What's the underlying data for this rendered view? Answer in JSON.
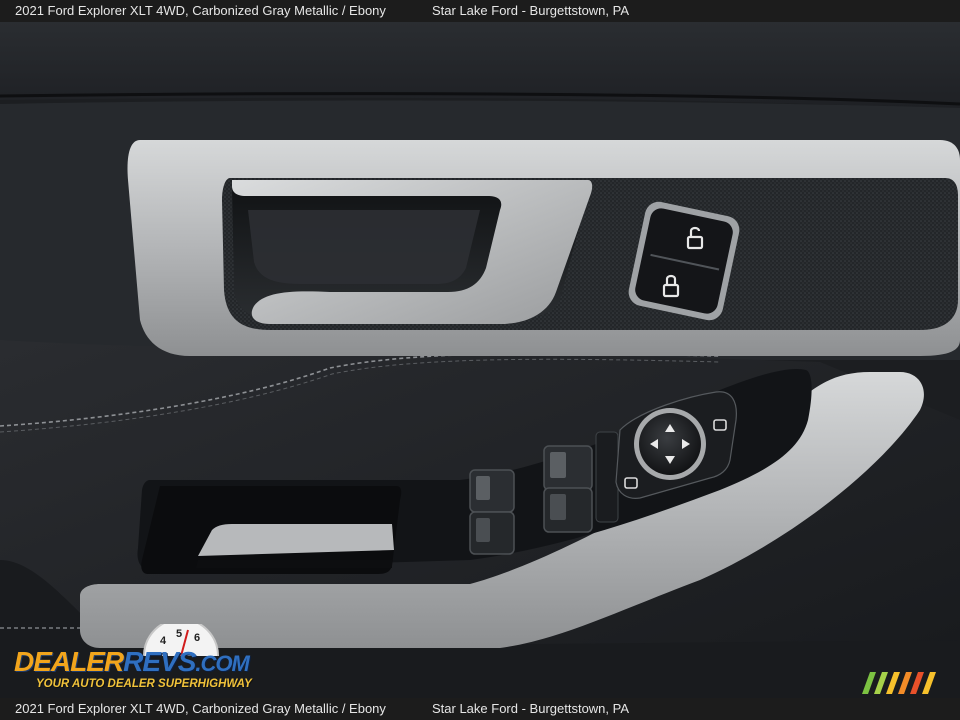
{
  "caption": {
    "vehicle": "2021 Ford Explorer XLT 4WD,   Carbonized Gray Metallic / Ebony",
    "dealer": "Star Lake Ford - Burgettstown, PA"
  },
  "watermark": {
    "brand_part1": "DEALER",
    "brand_part2": "REVS",
    "brand_suffix": ".COM",
    "tagline": "YOUR AUTO DEALER SUPERHIGHWAY",
    "gauge_digits": [
      "4",
      "5",
      "6"
    ]
  },
  "photo_subject": {
    "icons": [
      "unlock-icon",
      "lock-icon",
      "mirror-adjust-icon",
      "mirror-fold-icon",
      "window-switch-icon"
    ]
  },
  "colors": {
    "leather_dark": "#1b1d20",
    "trim_silver": "#b9bbbc",
    "brand_orange": "#f2a51c",
    "brand_blue": "#2f6fc0"
  }
}
